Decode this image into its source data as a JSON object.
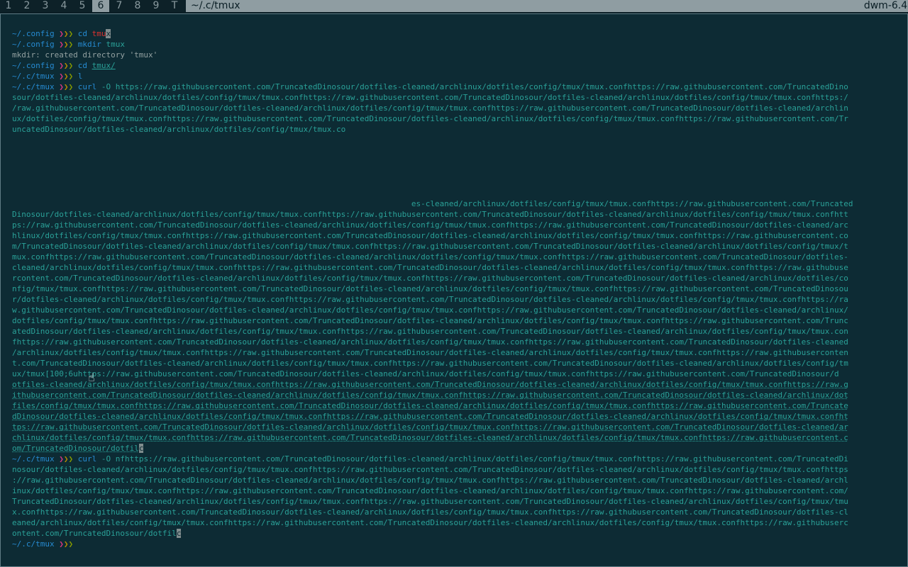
{
  "bar": {
    "tags": [
      {
        "label": "1",
        "selected": false
      },
      {
        "label": "2",
        "selected": false
      },
      {
        "label": "3",
        "selected": false
      },
      {
        "label": "4",
        "selected": false
      },
      {
        "label": "5",
        "selected": false
      },
      {
        "label": "6",
        "selected": true
      },
      {
        "label": "7",
        "selected": false
      },
      {
        "label": "8",
        "selected": false
      },
      {
        "label": "9",
        "selected": false
      },
      {
        "label": "T",
        "selected": false
      }
    ],
    "window_title": "~/.c/tmux",
    "wm_version": "dwm-6.4"
  },
  "terminal": {
    "prompt_arrows": "❯❯❯",
    "lines": [
      {
        "kind": "prompt",
        "dir": "~/.config",
        "cmd": "cd",
        "arg": "tmu",
        "cursor_char": "x",
        "arg_style": "red"
      },
      {
        "kind": "prompt",
        "dir": "~/.config",
        "cmd": "mkdir",
        "arg": "tmux",
        "arg_style": "plain"
      },
      {
        "kind": "output",
        "text": "mkdir: created directory 'tmux'"
      },
      {
        "kind": "prompt",
        "dir": "~/.config",
        "cmd": "cd",
        "arg": "tmux/",
        "arg_style": "underline"
      },
      {
        "kind": "prompt",
        "dir": "~/.c/tmux",
        "cmd": "l",
        "arg": "",
        "arg_style": "plain"
      },
      {
        "kind": "prompt",
        "dir": "~/.c/tmux",
        "cmd": "curl",
        "arg": "-O https://raw.githubusercontent.com/TruncatedDinosour/dotfiles-cleaned/archlinux/dotfiles/config/tmux/tmux.confhttps://raw.githubusercontent.com/TruncatedDino",
        "arg_style": "plain"
      },
      {
        "kind": "url",
        "text": "sour/dotfiles-cleaned/archlinux/dotfiles/config/tmux/tmux.confhttps://raw.githubusercontent.com/TruncatedDinosour/dotfiles-cleaned/archlinux/dotfiles/config/tmux/tmux.confhttps:/"
      },
      {
        "kind": "url",
        "text": "/raw.githubusercontent.com/TruncatedDinosour/dotfiles-cleaned/archlinux/dotfiles/config/tmux/tmux.confhttps://raw.githubusercontent.com/TruncatedDinosour/dotfiles-cleaned/archlin"
      },
      {
        "kind": "url",
        "text": "ux/dotfiles/config/tmux/tmux.confhttps://raw.githubusercontent.com/TruncatedDinosour/dotfiles-cleaned/archlinux/dotfiles/config/tmux/tmux.confhttps://raw.githubusercontent.com/Tr"
      },
      {
        "kind": "url",
        "text": "uncatedDinosour/dotfiles-cleaned/archlinux/dotfiles/config/tmux/tmux.co"
      },
      {
        "kind": "blank",
        "text": ""
      },
      {
        "kind": "blank",
        "text": ""
      },
      {
        "kind": "blank",
        "text": ""
      },
      {
        "kind": "blank",
        "text": ""
      },
      {
        "kind": "blank",
        "text": ""
      },
      {
        "kind": "blank",
        "text": ""
      },
      {
        "kind": "url",
        "text": "                                                                                     es-cleaned/archlinux/dotfiles/config/tmux/tmux.confhttps://raw.githubusercontent.com/Truncated"
      },
      {
        "kind": "url",
        "text": "Dinosour/dotfiles-cleaned/archlinux/dotfiles/config/tmux/tmux.confhttps://raw.githubusercontent.com/TruncatedDinosour/dotfiles-cleaned/archlinux/dotfiles/config/tmux/tmux.confhtt"
      },
      {
        "kind": "url",
        "text": "ps://raw.githubusercontent.com/TruncatedDinosour/dotfiles-cleaned/archlinux/dotfiles/config/tmux/tmux.confhttps://raw.githubusercontent.com/TruncatedDinosour/dotfiles-cleaned/arc"
      },
      {
        "kind": "url",
        "text": "hlinux/dotfiles/config/tmux/tmux.confhttps://raw.githubusercontent.com/TruncatedDinosour/dotfiles-cleaned/archlinux/dotfiles/config/tmux/tmux.confhttps://raw.githubusercontent.co"
      },
      {
        "kind": "url",
        "text": "m/TruncatedDinosour/dotfiles-cleaned/archlinux/dotfiles/config/tmux/tmux.confhttps://raw.githubusercontent.com/TruncatedDinosour/dotfiles-cleaned/archlinux/dotfiles/config/tmux/t"
      },
      {
        "kind": "url",
        "text": "mux.confhttps://raw.githubusercontent.com/TruncatedDinosour/dotfiles-cleaned/archlinux/dotfiles/config/tmux/tmux.confhttps://raw.githubusercontent.com/TruncatedDinosour/dotfiles-"
      },
      {
        "kind": "url",
        "text": "cleaned/archlinux/dotfiles/config/tmux/tmux.confhttps://raw.githubusercontent.com/TruncatedDinosour/dotfiles-cleaned/archlinux/dotfiles/config/tmux/tmux.confhttps://raw.githubuse"
      },
      {
        "kind": "url",
        "text": "rcontent.com/TruncatedDinosour/dotfiles-cleaned/archlinux/dotfiles/config/tmux/tmux.confhttps://raw.githubusercontent.com/TruncatedDinosour/dotfiles-cleaned/archlinux/dotfiles/co"
      },
      {
        "kind": "url",
        "text": "nfig/tmux/tmux.confhttps://raw.githubusercontent.com/TruncatedDinosour/dotfiles-cleaned/archlinux/dotfiles/config/tmux/tmux.confhttps://raw.githubusercontent.com/TruncatedDinosou"
      },
      {
        "kind": "url",
        "text": "r/dotfiles-cleaned/archlinux/dotfiles/config/tmux/tmux.confhttps://raw.githubusercontent.com/TruncatedDinosour/dotfiles-cleaned/archlinux/dotfiles/config/tmux/tmux.confhttps://ra"
      },
      {
        "kind": "url",
        "text": "w.githubusercontent.com/TruncatedDinosour/dotfiles-cleaned/archlinux/dotfiles/config/tmux/tmux.confhttps://raw.githubusercontent.com/TruncatedDinosour/dotfiles-cleaned/archlinux/"
      },
      {
        "kind": "url",
        "text": "dotfiles/config/tmux/tmux.confhttps://raw.githubusercontent.com/TruncatedDinosour/dotfiles-cleaned/archlinux/dotfiles/config/tmux/tmux.confhttps://raw.githubusercontent.com/Trunc"
      },
      {
        "kind": "url",
        "text": "atedDinosour/dotfiles-cleaned/archlinux/dotfiles/config/tmux/tmux.confhttps://raw.githubusercontent.com/TruncatedDinosour/dotfiles-cleaned/archlinux/dotfiles/config/tmux/tmux.con"
      },
      {
        "kind": "url",
        "text": "fhttps://raw.githubusercontent.com/TruncatedDinosour/dotfiles-cleaned/archlinux/dotfiles/config/tmux/tmux.confhttps://raw.githubusercontent.com/TruncatedDinosour/dotfiles-cleaned"
      },
      {
        "kind": "url",
        "text": "/archlinux/dotfiles/config/tmux/tmux.confhttps://raw.githubusercontent.com/TruncatedDinosour/dotfiles-cleaned/archlinux/dotfiles/config/tmux/tmux.confhttps://raw.githubuserconten"
      },
      {
        "kind": "url",
        "text": "t.com/TruncatedDinosour/dotfiles-cleaned/archlinux/dotfiles/config/tmux/tmux.confhttps://raw.githubusercontent.com/TruncatedDinosour/dotfiles-cleaned/archlinux/dotfiles/config/tm"
      },
      {
        "kind": "url",
        "text": "ux/tmux[100;6uhttps://raw.githubusercontent.com/TruncatedDinosour/dotfiles-cleaned/archlinux/dotfiles/config/tmux/tmux.confhttps://raw.githubusercontent.com/TruncatedDinosour/d"
      },
      {
        "kind": "url-u",
        "text": "otfiles-cleaned/archlinux/dotfiles/config/tmux/tmux.confhttps://raw.githubusercontent.com/TruncatedDinosour/dotfiles-cleaned/archlinux/dotfiles/config/tmux/tmux.confhttps://raw.g"
      },
      {
        "kind": "url-u",
        "text": "ithubusercontent.com/TruncatedDinosour/dotfiles-cleaned/archlinux/dotfiles/config/tmux/tmux.confhttps://raw.githubusercontent.com/TruncatedDinosour/dotfiles-cleaned/archlinux/dot"
      },
      {
        "kind": "url-u",
        "text": "files/config/tmux/tmux.confhttps://raw.githubusercontent.com/TruncatedDinosour/dotfiles-cleaned/archlinux/dotfiles/config/tmux/tmux.confhttps://raw.githubusercontent.com/Truncate"
      },
      {
        "kind": "url-u",
        "text": "dDinosour/dotfiles-cleaned/archlinux/dotfiles/config/tmux/tmux.confhttps://raw.githubusercontent.com/TruncatedDinosour/dotfiles-cleaned/archlinux/dotfiles/config/tmux/tmux.confht"
      },
      {
        "kind": "url-u",
        "text": "tps://raw.githubusercontent.com/TruncatedDinosour/dotfiles-cleaned/archlinux/dotfiles/config/tmux/tmux.confhttps://raw.githubusercontent.com/TruncatedDinosour/dotfiles-cleaned/ar"
      },
      {
        "kind": "url-u",
        "text": "chlinux/dotfiles/config/tmux/tmux.confhttps://raw.githubusercontent.com/TruncatedDinosour/dotfiles-cleaned/archlinux/dotfiles/config/tmux/tmux.confhttps://raw.githubusercontent.c"
      },
      {
        "kind": "url-u-cursor",
        "text": "om/TruncatedDinosour/dotfil",
        "cursor_char": "c"
      },
      {
        "kind": "prompt",
        "dir": "~/.c/tmux",
        "cmd": "curl",
        "arg": "-O nfhttps://raw.githubusercontent.com/TruncatedDinosour/dotfiles-cleaned/archlinux/dotfiles/config/tmux/tmux.confhttps://raw.githubusercontent.com/TruncatedDi",
        "arg_style": "plain"
      },
      {
        "kind": "url",
        "text": "nosour/dotfiles-cleaned/archlinux/dotfiles/config/tmux/tmux.confhttps://raw.githubusercontent.com/TruncatedDinosour/dotfiles-cleaned/archlinux/dotfiles/config/tmux/tmux.confhttps"
      },
      {
        "kind": "url",
        "text": "://raw.githubusercontent.com/TruncatedDinosour/dotfiles-cleaned/archlinux/dotfiles/config/tmux/tmux.confhttps://raw.githubusercontent.com/TruncatedDinosour/dotfiles-cleaned/archl"
      },
      {
        "kind": "url",
        "text": "inux/dotfiles/config/tmux/tmux.confhttps://raw.githubusercontent.com/TruncatedDinosour/dotfiles-cleaned/archlinux/dotfiles/config/tmux/tmux.confhttps://raw.githubusercontent.com/"
      },
      {
        "kind": "url",
        "text": "TruncatedDinosour/dotfiles-cleaned/archlinux/dotfiles/config/tmux/tmux.confhttps://raw.githubusercontent.com/TruncatedDinosour/dotfiles-cleaned/archlinux/dotfiles/config/tmux/tmu"
      },
      {
        "kind": "url",
        "text": "x.confhttps://raw.githubusercontent.com/TruncatedDinosour/dotfiles-cleaned/archlinux/dotfiles/config/tmux/tmux.confhttps://raw.githubusercontent.com/TruncatedDinosour/dotfiles-cl"
      },
      {
        "kind": "url",
        "text": "eaned/archlinux/dotfiles/config/tmux/tmux.confhttps://raw.githubusercontent.com/TruncatedDinosour/dotfiles-cleaned/archlinux/dotfiles/config/tmux/tmux.confhttps://raw.githubuserc"
      },
      {
        "kind": "url-cursor",
        "text": "ontent.com/TruncatedDinosour/dotfil",
        "cursor_char": "c"
      },
      {
        "kind": "prompt",
        "dir": "~/.c/tmux",
        "cmd": "",
        "arg": "",
        "arg_style": "plain"
      }
    ]
  },
  "colors": {
    "background": "#0d2b34",
    "prompt_dir": "#268bd2",
    "url_text": "#2aa198",
    "output_text": "#93a1a1",
    "accent_bar": "#8f9da2"
  },
  "icons": {
    "mouse_pointer": "hand-pointer-icon"
  }
}
